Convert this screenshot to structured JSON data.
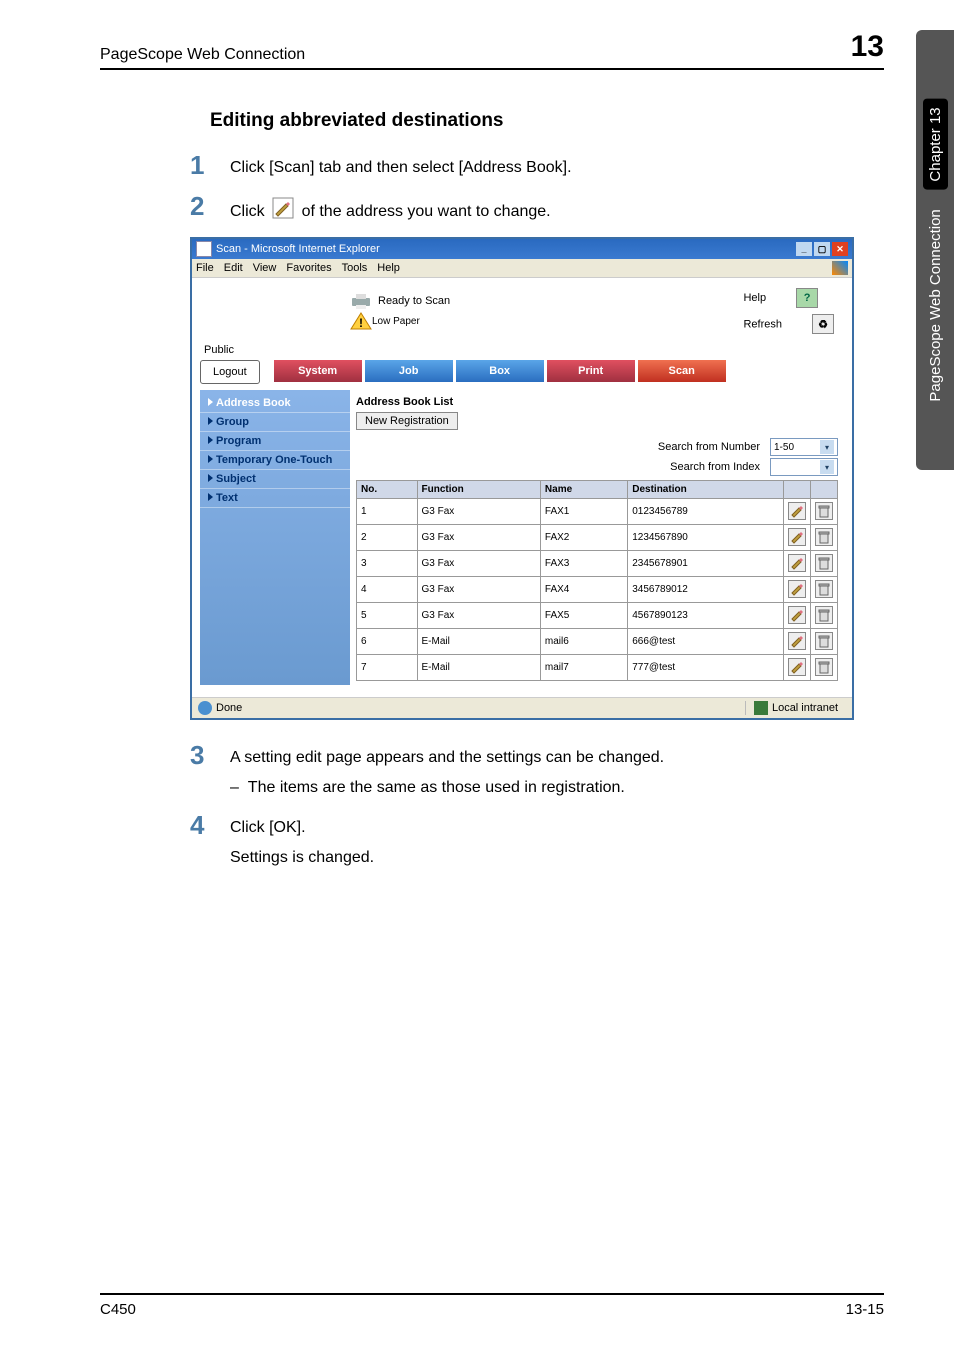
{
  "header": {
    "product": "PageScope Web Connection",
    "chapter_num": "13"
  },
  "sidebar": {
    "chapter_label": "Chapter 13",
    "product_label": "PageScope Web Connection"
  },
  "section_title": "Editing abbreviated destinations",
  "steps": {
    "s1": {
      "num": "1",
      "text": "Click [Scan] tab and then select [Address Book]."
    },
    "s2": {
      "num": "2",
      "text_a": "Click ",
      "text_b": " of the address you want to change."
    },
    "s3": {
      "num": "3",
      "text": "A setting edit page appears and the settings can be changed.",
      "sub": "The items are the same as those used in registration."
    },
    "s4": {
      "num": "4",
      "text": "Click [OK].",
      "sub": "Settings is changed."
    }
  },
  "shot": {
    "title": "Scan - Microsoft Internet Explorer",
    "menu": [
      "File",
      "Edit",
      "View",
      "Favorites",
      "Tools",
      "Help"
    ],
    "status_top": {
      "ready": "Ready to Scan",
      "low": "Low Paper"
    },
    "help": "Help",
    "refresh": "Refresh",
    "public": "Public",
    "logout": "Logout",
    "tabs": {
      "system": "System",
      "job": "Job",
      "box": "Box",
      "print": "Print",
      "scan": "Scan"
    },
    "nav": [
      "Address Book",
      "Group",
      "Program",
      "Temporary One-Touch",
      "Subject",
      "Text"
    ],
    "list_header": "Address Book List",
    "new_reg": "New Registration",
    "search_num": "Search from Number",
    "search_idx": "Search from Index",
    "range": "1-50",
    "cols": {
      "no": "No.",
      "func": "Function",
      "name": "Name",
      "dest": "Destination"
    },
    "rows": [
      {
        "no": "1",
        "func": "G3 Fax",
        "name": "FAX1",
        "dest": "0123456789"
      },
      {
        "no": "2",
        "func": "G3 Fax",
        "name": "FAX2",
        "dest": "1234567890"
      },
      {
        "no": "3",
        "func": "G3 Fax",
        "name": "FAX3",
        "dest": "2345678901"
      },
      {
        "no": "4",
        "func": "G3 Fax",
        "name": "FAX4",
        "dest": "3456789012"
      },
      {
        "no": "5",
        "func": "G3 Fax",
        "name": "FAX5",
        "dest": "4567890123"
      },
      {
        "no": "6",
        "func": "E-Mail",
        "name": "mail6",
        "dest": "666@test"
      },
      {
        "no": "7",
        "func": "E-Mail",
        "name": "mail7",
        "dest": "777@test"
      }
    ],
    "status": {
      "done": "Done",
      "zone": "Local intranet"
    }
  },
  "footer": {
    "left": "C450",
    "right": "13-15"
  }
}
